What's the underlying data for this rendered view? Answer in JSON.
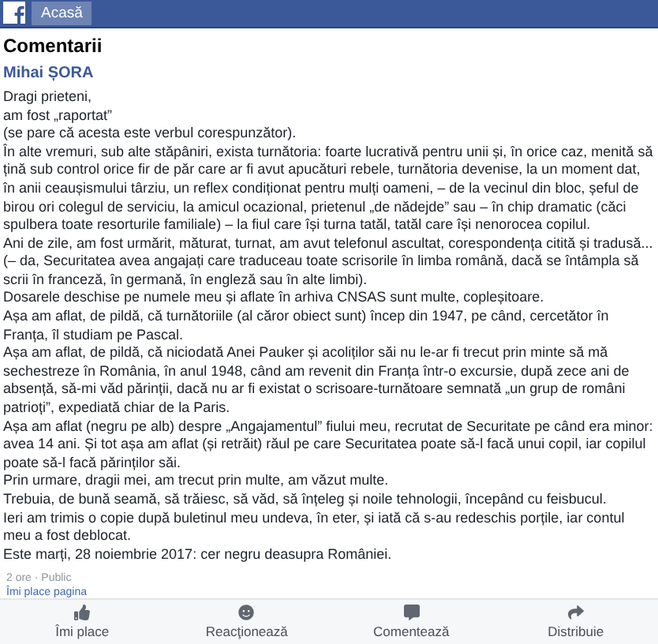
{
  "header": {
    "home_button": "Acasă"
  },
  "section_title": "Comentarii",
  "post": {
    "author": "Mihai ȘORA",
    "paragraphs": [
      "Dragi prieteni,",
      "am fost „raportat”",
      "(se pare că acesta este verbul corespunzător).",
      "În alte vremuri, sub alte stăpâniri, exista turnătoria: foarte lucrativă pentru unii și, în orice caz, menită să țină sub control orice fir de păr care ar fi avut apucături rebele, turnătoria devenise, la un moment dat, în anii ceaușismului târziu, un reflex condiționat pentru mulți oameni, – de la vecinul din bloc, șeful de birou ori colegul de serviciu, la amicul ocazional, prietenul „de nădejde” sau – în chip dramatic (căci spulbera toate resorturile familiale) – la fiul care își turna tatăl, tatăl care își nenorocea copilul.",
      "Ani de zile, am fost urmărit, măturat, turnat, am avut telefonul ascultat, corespondența citită și tradusă... (– da, Securitatea avea angajați care traduceau toate scrisorile în limba română, dacă se întâmpla să scrii în franceză, în germană, în engleză sau în alte limbi).",
      "Dosarele deschise pe numele meu și aflate în arhiva CNSAS sunt multe, copleșitoare.",
      "Așa am aflat, de pildă, că turnătoriile (al căror obiect sunt) încep din 1947, pe când, cercetător în Franța, îl studiam pe Pascal.",
      "Așa am aflat, de pildă, că niciodată Anei Pauker și acoliților săi nu le-ar fi trecut prin minte să mă sechestreze în România, în anul 1948, când am revenit din Franța într-o excursie, după zece ani de absență, să-mi văd părinții, dacă nu ar fi existat o scrisoare-turnătoare semnată „un grup de români patrioți”, expediată chiar de la Paris.",
      "Așa am aflat (negru pe alb) despre „Angajamentul” fiului meu, recrutat de Securitate pe când era minor: avea 14 ani. Și tot așa am aflat (și retrăit) răul pe care Securitatea poate să-l facă unui copil, iar copilul poate să-l facă părinților săi.",
      "Prin urmare, dragii mei, am trecut prin multe, am văzut multe.",
      "Trebuia, de bună seamă, să trăiesc, să văd, să înțeleg și noile tehnologii, începând cu feisbucul.",
      "Ieri am trimis o copie după buletinul meu undeva, în eter, și iată că s-au redeschis porțile, iar contul meu a fost deblocat.",
      "Este marți, 28 noiembrie 2017: cer negru deasupra României."
    ],
    "meta": "2 ore · Public",
    "like_page_link": "Îmi place pagina"
  },
  "actions": [
    {
      "kind": "like",
      "label": "Îmi place"
    },
    {
      "kind": "react",
      "label": "Reacţionează"
    },
    {
      "kind": "comment",
      "label": "Comentează"
    },
    {
      "kind": "share",
      "label": "Distribuie"
    }
  ]
}
